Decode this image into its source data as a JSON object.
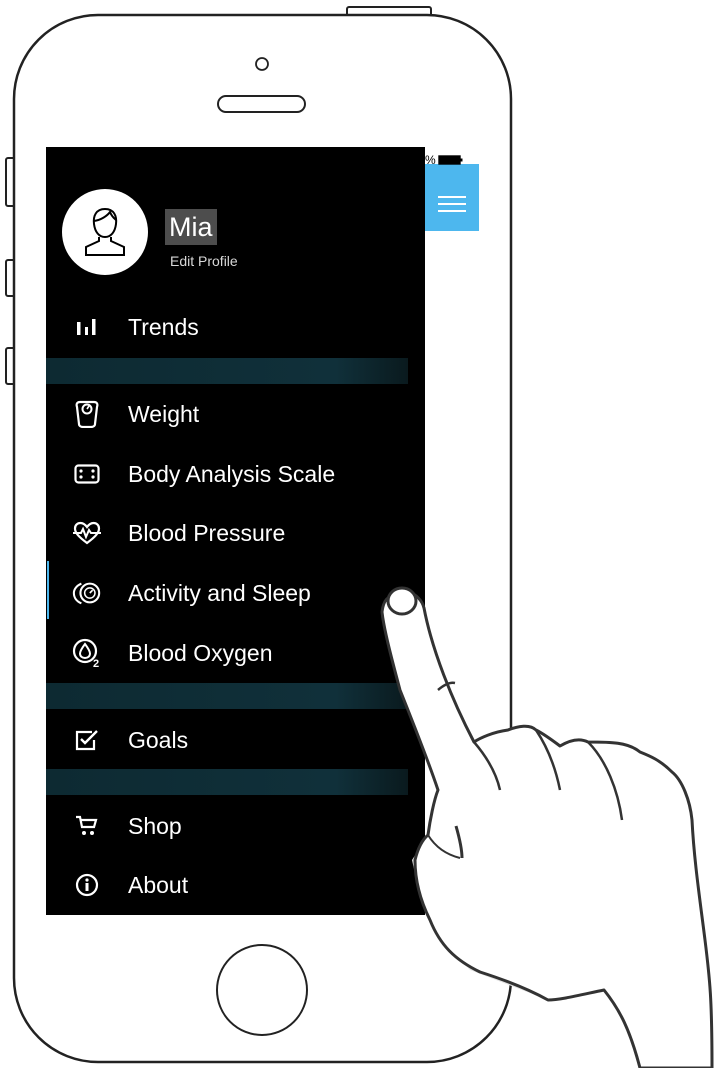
{
  "status_bar": {
    "battery_text": "%"
  },
  "user": {
    "name": "Mia",
    "edit_label": "Edit Profile"
  },
  "menu": [
    {
      "id": "trends",
      "label": "Trends",
      "icon": "bar-chart-icon"
    },
    {
      "id": "weight",
      "label": "Weight",
      "icon": "scale-icon"
    },
    {
      "id": "body-analysis-scale",
      "label": "Body Analysis Scale",
      "icon": "body-scale-icon"
    },
    {
      "id": "blood-pressure",
      "label": "Blood Pressure",
      "icon": "heart-pulse-icon"
    },
    {
      "id": "activity-and-sleep",
      "label": "Activity and Sleep",
      "icon": "activity-tracker-icon",
      "active": true
    },
    {
      "id": "blood-oxygen",
      "label": "Blood Oxygen",
      "icon": "o2-icon"
    },
    {
      "id": "goals",
      "label": "Goals",
      "icon": "checkbox-icon"
    },
    {
      "id": "shop",
      "label": "Shop",
      "icon": "cart-icon"
    },
    {
      "id": "about",
      "label": "About",
      "icon": "info-icon"
    }
  ],
  "colors": {
    "accent": "#4db7ee",
    "drawer_bg": "#000000",
    "separator": "#10303a",
    "name_highlight": "#4d4d4d"
  }
}
